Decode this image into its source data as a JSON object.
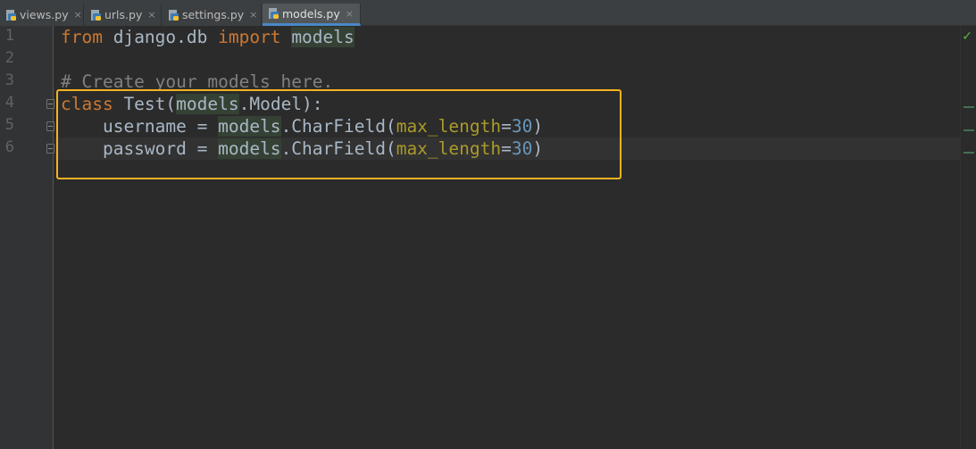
{
  "tabs": [
    {
      "label": "views.py",
      "active": false
    },
    {
      "label": "urls.py",
      "active": false
    },
    {
      "label": "settings.py",
      "active": false
    },
    {
      "label": "models.py",
      "active": true
    }
  ],
  "tab_close_glyph": "×",
  "icons": {
    "tab_file": "python-file-icon",
    "tab_close": "close-icon",
    "fold": "fold-marker-icon",
    "inspection": "checkmark-icon"
  },
  "line_numbers": [
    "1",
    "2",
    "3",
    "4",
    "5",
    "6"
  ],
  "code": {
    "line1": {
      "kw_from": "from",
      "module": " django.db ",
      "kw_import": "import",
      "space": " ",
      "name": "models"
    },
    "line3": {
      "comment": "# Create your models here."
    },
    "line4": {
      "kw_class": "class",
      "name": " Test(",
      "ref": "models",
      "rest": ".Model):"
    },
    "line5": {
      "indent": "    username = ",
      "ref": "models",
      "call": ".CharField(",
      "param": "max_length",
      "eq": "=",
      "num": "30",
      "close": ")"
    },
    "line6": {
      "indent": "    password = ",
      "ref": "models",
      "call": ".CharField(",
      "param": "max_length",
      "eq": "=",
      "num": "30",
      "close": ")"
    }
  },
  "inspection_glyph": "✓",
  "colors": {
    "background": "#2b2b2b",
    "keyword": "#cc7832",
    "comment": "#808080",
    "parameter": "#aa9b2a",
    "number": "#6897bb",
    "highlight_box": "#f2b21f",
    "tab_active_underline": "#4a88c7"
  }
}
